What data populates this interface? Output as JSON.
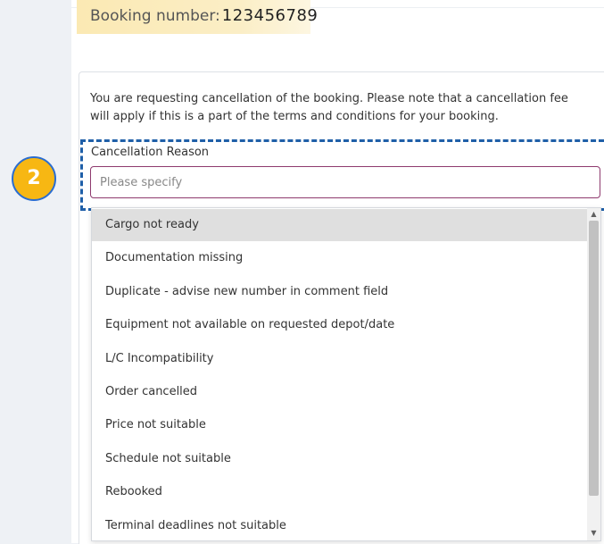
{
  "booking": {
    "label": "Booking number:",
    "number": "123456789"
  },
  "notice": "You are requesting cancellation of the booking. Please note that a cancellation fee will apply if this is a part of the terms and conditions for your booking.",
  "cancellation": {
    "label": "Cancellation Reason",
    "placeholder": "Please specify",
    "value": ""
  },
  "step_badge": "2",
  "dropdown": {
    "options": [
      "Cargo not ready",
      "Documentation missing",
      "Duplicate - advise new number in comment field",
      "Equipment not available on requested depot/date",
      "L/C Incompatibility",
      "Order cancelled",
      "Price not suitable",
      "Schedule not suitable",
      "Rebooked",
      "Terminal deadlines not suitable"
    ],
    "highlighted_index": 0,
    "scroll_up_icon": "triangle-up",
    "scroll_down_icon": "triangle-down"
  },
  "colors": {
    "highlight_border": "#1f5fa8",
    "badge_fill": "#f7b713",
    "input_border": "#8e3a6e",
    "booking_highlight": "#fbe9b3"
  }
}
